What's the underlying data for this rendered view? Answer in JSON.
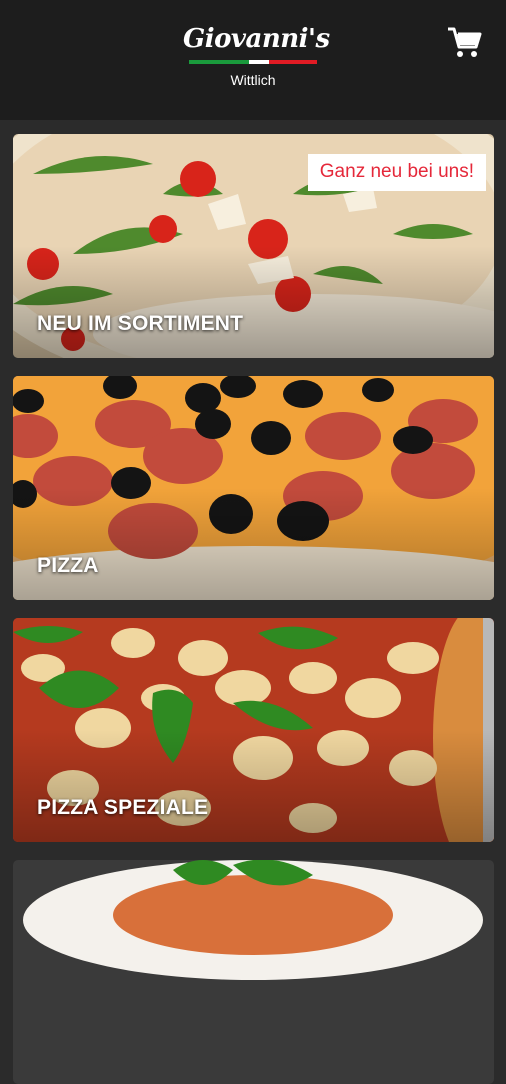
{
  "header": {
    "logo_text": "Giovanni's",
    "location": "Wittlich",
    "cart_icon": "shopping-cart-icon",
    "colors": {
      "background": "#1d1d1d",
      "text": "#ffffff",
      "stripe_green": "#1a9a3c",
      "stripe_red": "#e01b24"
    }
  },
  "categories": [
    {
      "title": "NEU IM SORTIMENT",
      "badge": "Ganz neu bei uns!"
    },
    {
      "title": "PIZZA"
    },
    {
      "title": "PIZZA SPEZIALE"
    },
    {
      "title": ""
    }
  ],
  "colors": {
    "page_background": "#2b2b2b",
    "badge_text": "#e5283a",
    "badge_background": "#ffffff"
  }
}
